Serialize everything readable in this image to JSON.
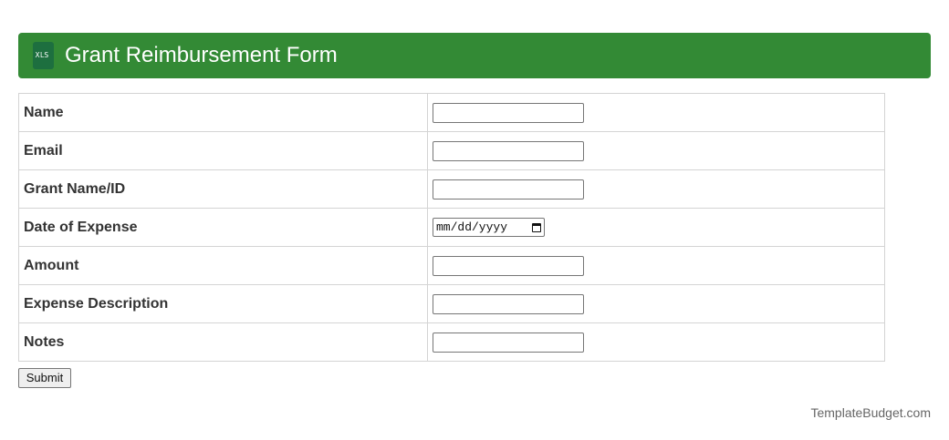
{
  "header": {
    "title": "Grant Reimbursement Form",
    "icon": "xls-file-icon",
    "icon_text": "XLS",
    "background_color": "#338a35"
  },
  "form": {
    "fields": [
      {
        "label": "Name",
        "type": "text",
        "value": ""
      },
      {
        "label": "Email",
        "type": "text",
        "value": ""
      },
      {
        "label": "Grant Name/ID",
        "type": "text",
        "value": ""
      },
      {
        "label": "Date of Expense",
        "type": "date",
        "placeholder": "mm/dd/yyyy",
        "icon": "calendar-icon"
      },
      {
        "label": "Amount",
        "type": "text",
        "value": ""
      },
      {
        "label": "Expense Description",
        "type": "text",
        "value": ""
      },
      {
        "label": "Notes",
        "type": "text",
        "value": ""
      }
    ],
    "submit_label": "Submit"
  },
  "footer": {
    "brand": "TemplateBudget.com"
  }
}
